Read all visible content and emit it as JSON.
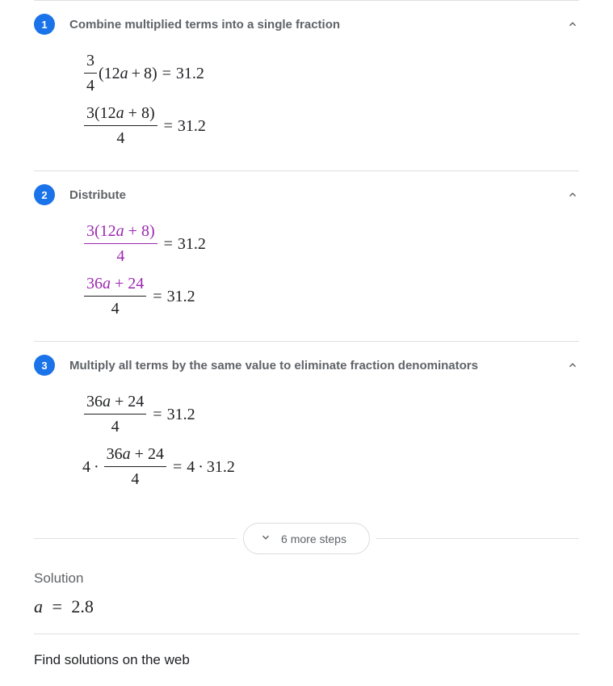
{
  "steps": [
    {
      "number": "1",
      "title": "Combine multiplied terms into a single fraction"
    },
    {
      "number": "2",
      "title": "Distribute"
    },
    {
      "number": "3",
      "title": "Multiply all terms by the same value to eliminate fraction denominators"
    }
  ],
  "math": {
    "step1": {
      "line1": {
        "frac_num": "3",
        "frac_den": "4",
        "paren_open": "(",
        "coef": "12",
        "var": "a",
        "plus": "+",
        "const": "8",
        "paren_close": ")",
        "eq": "=",
        "rhs": "31.2"
      },
      "line2": {
        "frac_num_a": "3(12",
        "frac_num_var": "a",
        "frac_num_b": " + 8)",
        "frac_den": "4",
        "eq": "=",
        "rhs": "31.2"
      }
    },
    "step2": {
      "line1": {
        "frac_num_a": "3(12",
        "frac_num_var": "a",
        "frac_num_b": " + 8)",
        "frac_den": "4",
        "eq": "=",
        "rhs": "31.2"
      },
      "line2": {
        "frac_num_a": "36",
        "frac_num_var": "a",
        "frac_num_b": " + 24",
        "frac_den": "4",
        "eq": "=",
        "rhs": "31.2"
      }
    },
    "step3": {
      "line1": {
        "frac_num_a": "36",
        "frac_num_var": "a",
        "frac_num_b": " + 24",
        "frac_den": "4",
        "eq": "=",
        "rhs": "31.2"
      },
      "line2": {
        "lead": "4",
        "dot": "·",
        "frac_num_a": "36",
        "frac_num_var": "a",
        "frac_num_b": " + 24",
        "frac_den": "4",
        "eq": "=",
        "rhs_a": "4",
        "rhs_dot": "·",
        "rhs_b": "31.2"
      }
    }
  },
  "more_steps": "6 more steps",
  "solution_label": "Solution",
  "solution": {
    "var": "a",
    "eq": "=",
    "val": "2.8"
  },
  "footer": "Find solutions on the web"
}
